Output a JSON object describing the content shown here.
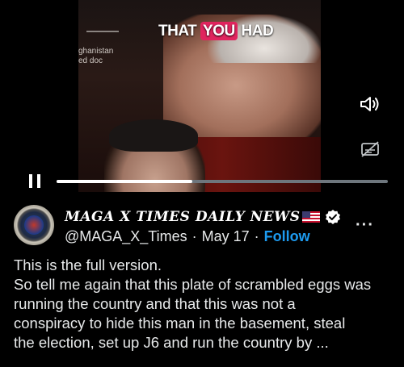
{
  "video": {
    "caption_prefix": "THAT",
    "caption_highlight": "YOU",
    "caption_suffix": "HAD",
    "bg_text": "ghanistan\ned doc",
    "progress": 0.41
  },
  "icons": {
    "sound": "speaker-icon",
    "captions": "captions-off-icon",
    "pause": "pause-icon",
    "verified": "verified-badge-icon",
    "more": "more-icon",
    "flag": "us-flag-icon"
  },
  "post": {
    "display_name": "MAGA X TIMES DAILY NEWS",
    "handle": "@MAGA_X_Times",
    "separator": "·",
    "date": "May 17",
    "follow_label": "Follow",
    "more_label": "···",
    "text_lines": [
      "This is the full version.",
      "So tell me again that this plate of scrambled eggs was",
      "running the country and that this was not a",
      "conspiracy to hide this man in the basement, steal",
      "the election, set up J6 and run the country by ..."
    ]
  },
  "colors": {
    "background": "#000000",
    "text": "#e7e9ea",
    "accent": "#1d9bf0",
    "caption_highlight": "#e0245e",
    "verified": "#ffffff"
  }
}
